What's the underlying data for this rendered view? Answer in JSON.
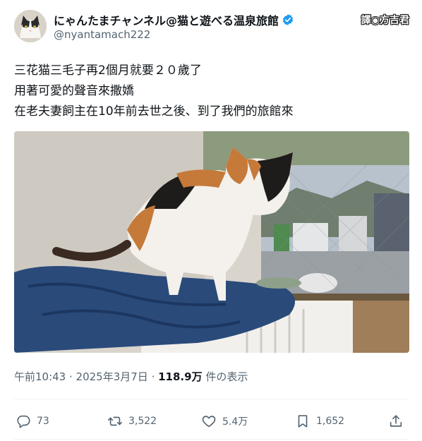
{
  "author": {
    "display_name": "にゃんたまチャンネル@猫と遊べる温泉旅館",
    "handle": "@nyantamach222",
    "avatar_icon": "cat-avatar-icon",
    "verified_icon": "verified-badge-icon",
    "verified_color": "#1d9bf0"
  },
  "watermark": "譯◉方吉君",
  "tweet": {
    "lines": [
      "三花猫三毛子再2個月就要２０歲了",
      "用著可愛的聲音來撒嬌",
      "在老夫妻飼主在10年前去世之後、到了我們的旅館來"
    ]
  },
  "meta": {
    "time": "午前10:43",
    "sep1": " · ",
    "date": "2025年3月7日",
    "sep2": " · ",
    "views_count": "118.9万",
    "views_label": " 件の表示"
  },
  "actions": {
    "reply": {
      "icon": "reply-icon",
      "count": "73"
    },
    "retweet": {
      "icon": "retweet-icon",
      "count": "3,522"
    },
    "like": {
      "icon": "heart-icon",
      "count": "5.4万"
    },
    "bookmark": {
      "icon": "bookmark-icon",
      "count": "1,652"
    },
    "share": {
      "icon": "share-icon"
    }
  }
}
